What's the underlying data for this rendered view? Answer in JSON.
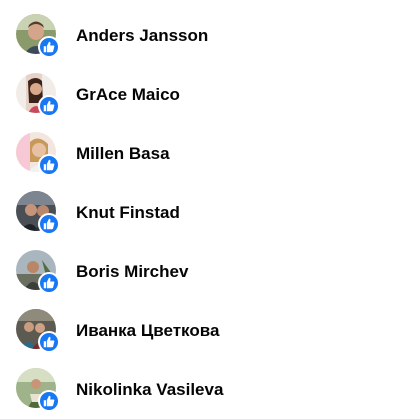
{
  "colors": {
    "like_badge": "#1877f2",
    "name_text": "#050505"
  },
  "reactions": [
    {
      "name": "Anders Jansson",
      "reaction_icon": "like-icon"
    },
    {
      "name": "GrAce Maico",
      "reaction_icon": "like-icon"
    },
    {
      "name": "Millen Basa",
      "reaction_icon": "like-icon"
    },
    {
      "name": "Knut Finstad",
      "reaction_icon": "like-icon"
    },
    {
      "name": "Boris Mirchev",
      "reaction_icon": "like-icon"
    },
    {
      "name": "Иванка Цветкова",
      "reaction_icon": "like-icon"
    },
    {
      "name": "Nikolinka Vasileva",
      "reaction_icon": "like-icon"
    }
  ]
}
